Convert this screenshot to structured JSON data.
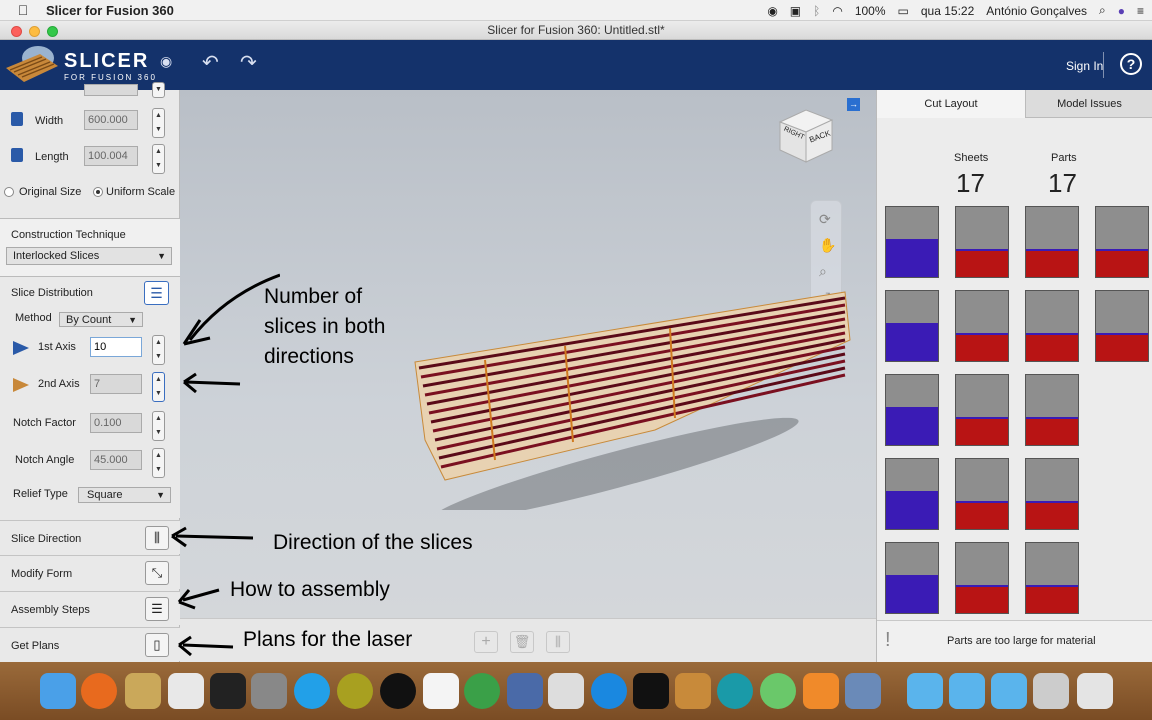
{
  "menubar": {
    "app_name": "Slicer for Fusion 360",
    "battery": "100%",
    "clock": "qua 15:22",
    "user": "António Gonçalves"
  },
  "window": {
    "title": "Slicer for Fusion 360: Untitled.stl*"
  },
  "header": {
    "brand_line1": "SLICER",
    "brand_line2": "FOR FUSION 360",
    "sign_in": "Sign In",
    "help": "?"
  },
  "left_panel": {
    "width_label": "Width",
    "width_value": "600.000",
    "length_label": "Length",
    "length_value": "100.004",
    "original_size": "Original Size",
    "uniform_scale": "Uniform Scale",
    "construction_technique_label": "Construction Technique",
    "construction_technique_value": "Interlocked Slices",
    "slice_distribution_label": "Slice Distribution",
    "method_label": "Method",
    "method_value": "By Count",
    "axis1_label": "1st Axis",
    "axis1_value": "10",
    "axis2_label": "2nd Axis",
    "axis2_value": "7",
    "notch_factor_label": "Notch Factor",
    "notch_factor_value": "0.100",
    "notch_angle_label": "Notch Angle",
    "notch_angle_value": "45.000",
    "relief_type_label": "Relief Type",
    "relief_type_value": "Square",
    "slice_direction": "Slice Direction",
    "modify_form": "Modify Form",
    "assembly_steps": "Assembly Steps",
    "get_plans": "Get Plans"
  },
  "viewcube": {
    "right": "RIGHT",
    "back": "BACK"
  },
  "annotations": {
    "slices_count_line1": "Number of",
    "slices_count_line2": "slices in both",
    "slices_count_line3": "directions",
    "direction": "Direction of the slices",
    "assembly": "How to assembly",
    "plans": "Plans for the laser"
  },
  "right_panel": {
    "tab_cut_layout": "Cut Layout",
    "tab_model_issues": "Model Issues",
    "sheets_label": "Sheets",
    "sheets_count": "17",
    "parts_label": "Parts",
    "parts_count": "17",
    "status_message": "Parts are too large for material",
    "status_icon": "!"
  },
  "colors": {
    "header_bg": "#14326b",
    "slice_red": "#b81414",
    "slice_blue": "#3a1bb5"
  }
}
